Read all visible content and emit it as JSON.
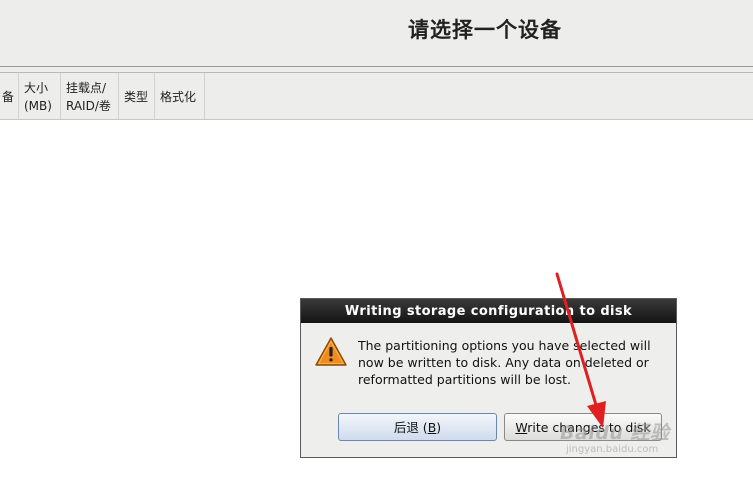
{
  "header": {
    "title": "请选择一个设备"
  },
  "columns": [
    {
      "label": "备"
    },
    {
      "label": "大小\n(MB)"
    },
    {
      "label": "挂载点/\nRAID/卷"
    },
    {
      "label": "类型"
    },
    {
      "label": "格式化"
    }
  ],
  "dialog": {
    "title": "Writing storage configuration to disk",
    "message": "The partitioning options you have selected will now be written to disk.  Any data on deleted or reformatted partitions will be lost.",
    "icon": "warning-icon",
    "buttons": {
      "back": {
        "label_prefix": "后退 (",
        "mnemonic": "B",
        "label_suffix": ")"
      },
      "write": {
        "mnemonic": "W",
        "label_rest": "rite changes to disk"
      }
    }
  },
  "watermark": {
    "main": "Baidu 经验",
    "sub": "jingyan.baidu.com"
  },
  "colors": {
    "annotation_arrow": "#e02020",
    "dialog_title_bg": "#1e1e1e",
    "warning_fill": "#f08c1e"
  }
}
